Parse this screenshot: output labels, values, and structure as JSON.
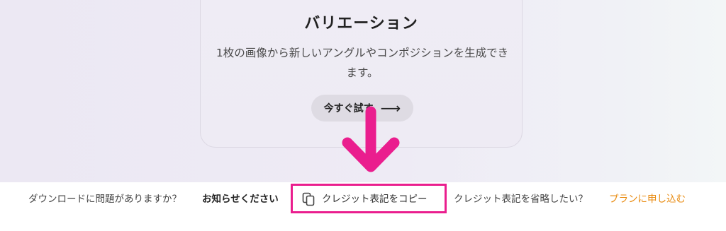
{
  "card": {
    "title": "バリエーション",
    "description": "1枚の画像から新しいアングルやコンポジションを生成できます。",
    "button_label": "今すぐ試す",
    "button_icon": "arrow-right-icon"
  },
  "footer": {
    "problem_text": "ダウンロードに問題がありますか？",
    "notify_link": "お知らせください",
    "copy_credit_label": "クレジット表記をコピー",
    "copy_icon": "copy-icon",
    "omit_credit_text": "クレジット表記を省略したい？",
    "plan_link": "プランに申し込む"
  },
  "colors": {
    "annotation": "#ea1e8e",
    "link_accent": "#e8890c"
  }
}
